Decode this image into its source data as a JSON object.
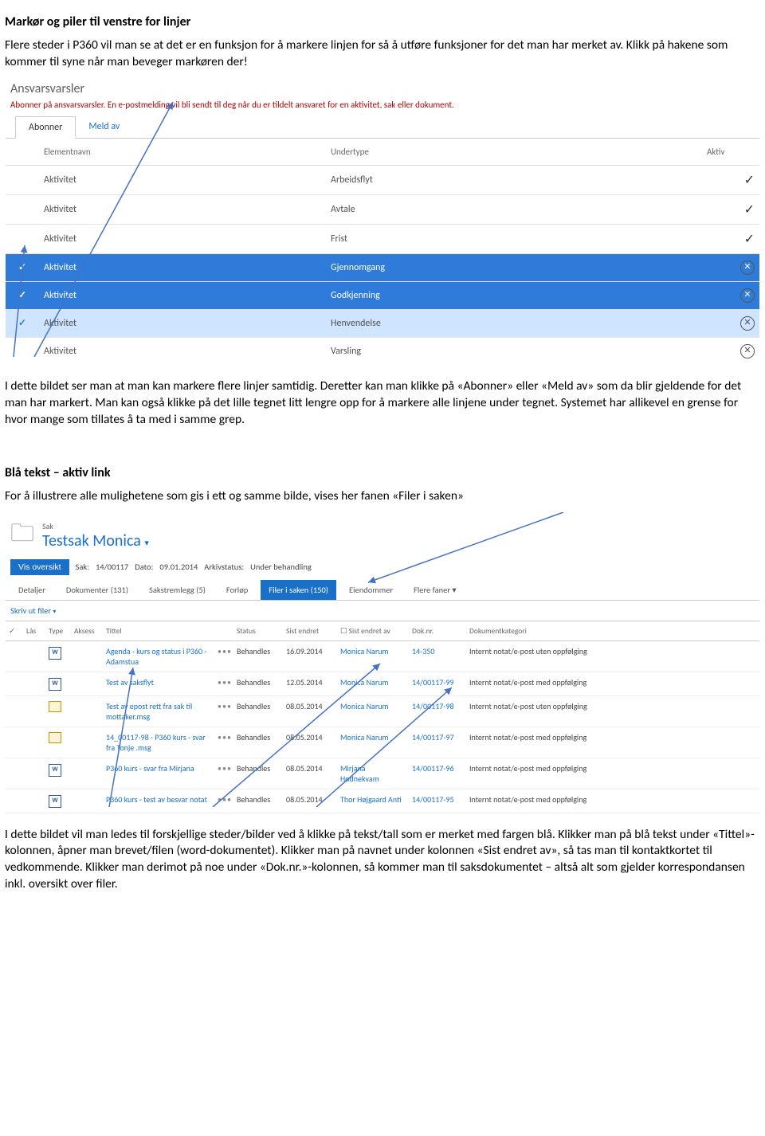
{
  "doc": {
    "h1": "Markør og piler til venstre for linjer",
    "p1": "Flere steder i P360 vil man se at det er en funksjon for å markere linjen for så å utføre funksjoner for det man har merket av. Klikk på hakene som kommer til syne når man beveger markøren der!",
    "p2": "I dette bildet ser man at man kan markere flere linjer samtidig. Deretter kan man klikke på «Abonner» eller «Meld av» som da blir gjeldende for det man har markert. Man kan også klikke på det lille tegnet litt lengre opp for å markere alle linjene under tegnet. Systemet har allikevel en grense for hvor mange som tillates å ta med i samme grep.",
    "h2": "Blå tekst – aktiv link",
    "p3": "For å illustrere alle mulighetene som gis i ett og samme bilde, vises her fanen «Filer i saken»",
    "p4": "I dette bildet vil man ledes til forskjellige steder/bilder ved å klikke på tekst/tall som er merket med fargen blå. Klikker man på blå tekst under «Tittel»-kolonnen, åpner man brevet/filen (word-dokumentet). Klikker man på navnet under kolonnen «Sist endret av», så tas man til kontaktkortet til vedkommende. Klikker man derimot på noe under «Dok.nr.»-kolonnen, så kommer man til saksdokumentet – altså alt som gjelder korrespondansen inkl. oversikt over filer."
  },
  "ss1": {
    "title": "Ansvarsvarsler",
    "desc": "Abonner på ansvarsvarsler. En e-postmelding vil bli sendt til deg når du er tildelt ansvaret for en aktivitet, sak eller dokument.",
    "tabs": {
      "abonner": "Abonner",
      "meldav": "Meld av"
    },
    "headers": {
      "col1": "Elementnavn",
      "col2": "Undertype",
      "col3": "Aktiv"
    },
    "rows": [
      {
        "sel": false,
        "c1": "Aktivitet",
        "c2": "Arbeidsflyt",
        "state": "tick"
      },
      {
        "sel": false,
        "c1": "Aktivitet",
        "c2": "Avtale",
        "state": "tick"
      },
      {
        "sel": false,
        "c1": "Aktivitet",
        "c2": "Frist",
        "state": "tick"
      },
      {
        "sel": "full",
        "c1": "Aktivitet",
        "c2": "Gjennomgang",
        "state": "x"
      },
      {
        "sel": "full",
        "c1": "Aktivitet",
        "c2": "Godkjenning",
        "state": "x"
      },
      {
        "sel": "light",
        "c1": "Aktivitet",
        "c2": "Henvendelse",
        "state": "x"
      },
      {
        "sel": false,
        "c1": "Aktivitet",
        "c2": "Varsling",
        "state": "x"
      }
    ]
  },
  "ss2": {
    "breadcrumb": "Sak",
    "title": "Testsak Monica",
    "btn": "Vis oversikt",
    "sak_label": "Sak:",
    "sak_val": "14/00117",
    "dato_label": "Dato:",
    "dato_val": "09.01.2014",
    "ark_label": "Arkivstatus:",
    "ark_val": "Under behandling",
    "tabs": [
      "Detaljer",
      "Dokumenter (131)",
      "Sakstremlegg (5)",
      "Forløp",
      "Filer i saken (150)",
      "Eiendommer",
      "Flere faner"
    ],
    "active_tab": 4,
    "print": "Skriv ut filer",
    "headers": [
      "",
      "Lås",
      "Type",
      "Aksess",
      "Tittel",
      "",
      "Status",
      "Sist endret",
      "Sist endret av",
      "Dok.nr.",
      "Dokumentkategori"
    ],
    "checkbox_label": "☐",
    "rows": [
      {
        "type": "w",
        "title": "Agenda - kurs og status i P360 - Adamstua",
        "status": "Behandles",
        "date": "16.09.2014",
        "by": "Monica Narum",
        "nr": "14-350",
        "cat": "Internt notat/e-post uten oppfølging"
      },
      {
        "type": "w",
        "title": "Test av saksflyt",
        "status": "Behandles",
        "date": "12.05.2014",
        "by": "Monica Narum",
        "nr": "14/00117-99",
        "cat": "Internt notat/e-post med oppfølging"
      },
      {
        "type": "m",
        "title": "Test av epost rett fra sak til mottaker.msg",
        "status": "Behandles",
        "date": "08.05.2014",
        "by": "Monica Narum",
        "nr": "14/00117-98",
        "cat": "Internt notat/e-post uten oppfølging"
      },
      {
        "type": "m",
        "title": "14_00117-98 - P360 kurs - svar fra Tonje .msg",
        "status": "Behandles",
        "date": "08.05.2014",
        "by": "Monica Narum",
        "nr": "14/00117-97",
        "cat": "Internt notat/e-post med oppfølging"
      },
      {
        "type": "w",
        "title": "P360 kurs - svar fra Mirjana",
        "status": "Behandles",
        "date": "08.05.2014",
        "by": "Mirjana Hodnekvam",
        "nr": "14/00117-96",
        "cat": "Internt notat/e-post med oppfølging"
      },
      {
        "type": "w",
        "title": "P360 kurs - test av besvar notat",
        "status": "Behandles",
        "date": "08.05.2014",
        "by": "Thor Højgaard Anti",
        "nr": "14/00117-95",
        "cat": "Internt notat/e-post med oppfølging"
      }
    ]
  }
}
